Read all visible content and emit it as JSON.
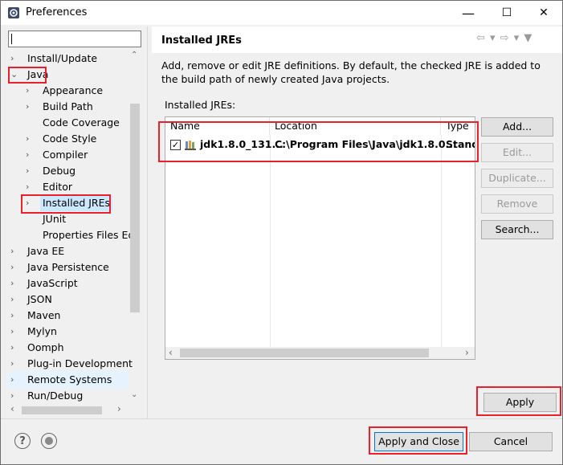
{
  "window": {
    "title": "Preferences",
    "minimize_glyph": "—",
    "maximize_glyph": "☐",
    "close_glyph": "✕"
  },
  "filter": {
    "value": "",
    "placeholder": ""
  },
  "tree": [
    {
      "label": "Install/Update",
      "level": 0,
      "arrow": "›"
    },
    {
      "label": "Java",
      "level": 0,
      "arrow": "⌄",
      "expanded": true
    },
    {
      "label": "Appearance",
      "level": 1,
      "arrow": "›"
    },
    {
      "label": "Build Path",
      "level": 1,
      "arrow": "›"
    },
    {
      "label": "Code Coverage",
      "level": 1,
      "arrow": ""
    },
    {
      "label": "Code Style",
      "level": 1,
      "arrow": "›"
    },
    {
      "label": "Compiler",
      "level": 1,
      "arrow": "›"
    },
    {
      "label": "Debug",
      "level": 1,
      "arrow": "›"
    },
    {
      "label": "Editor",
      "level": 1,
      "arrow": "›"
    },
    {
      "label": "Installed JREs",
      "level": 1,
      "arrow": "›",
      "selected": true
    },
    {
      "label": "JUnit",
      "level": 1,
      "arrow": ""
    },
    {
      "label": "Properties Files Ed",
      "level": 1,
      "arrow": ""
    },
    {
      "label": "Java EE",
      "level": 0,
      "arrow": "›"
    },
    {
      "label": "Java Persistence",
      "level": 0,
      "arrow": "›"
    },
    {
      "label": "JavaScript",
      "level": 0,
      "arrow": "›"
    },
    {
      "label": "JSON",
      "level": 0,
      "arrow": "›"
    },
    {
      "label": "Maven",
      "level": 0,
      "arrow": "›"
    },
    {
      "label": "Mylyn",
      "level": 0,
      "arrow": "›"
    },
    {
      "label": "Oomph",
      "level": 0,
      "arrow": "›"
    },
    {
      "label": "Plug-in Development",
      "level": 0,
      "arrow": "›"
    },
    {
      "label": "Remote Systems",
      "level": 0,
      "arrow": "›"
    },
    {
      "label": "Run/Debug",
      "level": 0,
      "arrow": "›"
    }
  ],
  "page": {
    "title": "Installed JREs",
    "nav": "⇦ ▾ ⇨ ▾ ▼",
    "description": "Add, remove or edit JRE definitions. By default, the checked JRE is added to the build path of newly created Java projects.",
    "jres_label": "Installed JREs:",
    "columns": [
      "Name",
      "Location",
      "Type"
    ],
    "rows": [
      {
        "checked": true,
        "check_glyph": "✓",
        "name": "jdk1.8.0_131...",
        "location": "C:\\Program Files\\Java\\jdk1.8.0...",
        "type": "Stand"
      }
    ],
    "buttons": {
      "add": "Add...",
      "edit": "Edit...",
      "duplicate": "Duplicate...",
      "remove": "Remove",
      "search": "Search..."
    },
    "apply": "Apply"
  },
  "footer": {
    "help_glyph": "?",
    "apply_and_close": "Apply and Close",
    "cancel": "Cancel"
  },
  "colors": {
    "highlight": "#e8212b",
    "selection": "#cce8ff",
    "hover": "#e5f3ff"
  },
  "icons": [
    "eclipse-preferences-icon",
    "help-icon",
    "import-export-icon",
    "jre-library-icon",
    "checkbox-icon"
  ]
}
